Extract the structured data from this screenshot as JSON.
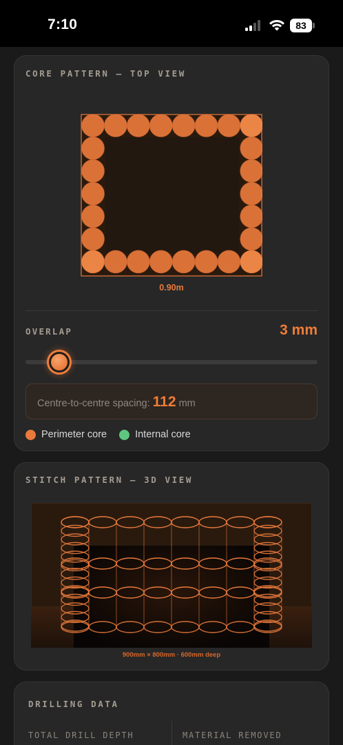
{
  "status_bar": {
    "time": "7:10",
    "battery": "83",
    "icons": [
      "signal-icon",
      "wifi-icon",
      "battery-icon"
    ]
  },
  "core_pattern": {
    "title": "CORE PATTERN — TOP VIEW",
    "width_label": "0.90m",
    "overlap_label": "OVERLAP",
    "overlap_value": "3 mm",
    "overlap_slider_fraction": 0.05,
    "spacing_label": "Centre-to-centre spacing:",
    "spacing_value": "112",
    "spacing_unit": "mm",
    "legend": [
      {
        "label": "Perimeter core",
        "color": "#e97a3c"
      },
      {
        "label": "Internal core",
        "color": "#5ec77f"
      }
    ]
  },
  "stitch_pattern": {
    "title": "STITCH PATTERN — 3D VIEW",
    "caption": "900mm × 800mm · 600mm deep"
  },
  "drilling_data": {
    "title": "DRILLING DATA",
    "columns": [
      "TOTAL DRILL DEPTH",
      "MATERIAL REMOVED"
    ]
  },
  "colors": {
    "accent": "#ef7d3a",
    "card_bg": "#272727",
    "page_bg": "#1a1a1a"
  }
}
